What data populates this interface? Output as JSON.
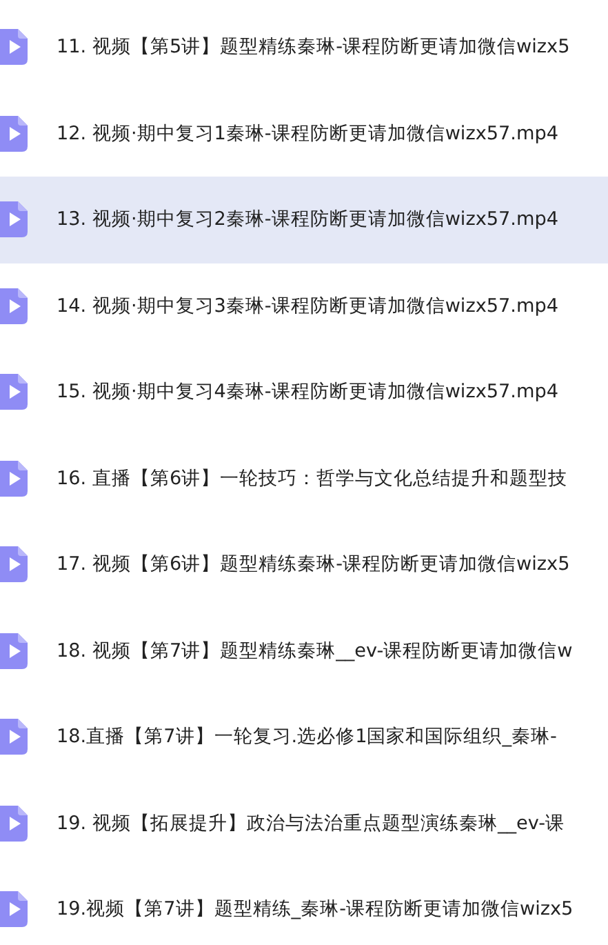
{
  "files": [
    {
      "name": "11. 视频【第5讲】题型精练秦琳-课程防断更请加微信wizx5",
      "selected": false
    },
    {
      "name": "12. 视频·期中复习1秦琳-课程防断更请加微信wizx57.mp4",
      "selected": false
    },
    {
      "name": "13. 视频·期中复习2秦琳-课程防断更请加微信wizx57.mp4",
      "selected": true
    },
    {
      "name": "14. 视频·期中复习3秦琳-课程防断更请加微信wizx57.mp4",
      "selected": false
    },
    {
      "name": "15. 视频·期中复习4秦琳-课程防断更请加微信wizx57.mp4",
      "selected": false
    },
    {
      "name": "16. 直播【第6讲】一轮技巧：哲学与文化总结提升和题型技",
      "selected": false
    },
    {
      "name": "17. 视频【第6讲】题型精练秦琳-课程防断更请加微信wizx5",
      "selected": false
    },
    {
      "name": "18. 视频【第7讲】题型精练秦琳__ev-课程防断更请加微信w",
      "selected": false
    },
    {
      "name": "18.直播【第7讲】一轮复习.选必修1国家和国际组织_秦琳-",
      "selected": false
    },
    {
      "name": "19. 视频【拓展提升】政治与法治重点题型演练秦琳__ev-课",
      "selected": false
    },
    {
      "name": "19.视频【第7讲】题型精练_秦琳-课程防断更请加微信wizx5",
      "selected": false
    }
  ]
}
